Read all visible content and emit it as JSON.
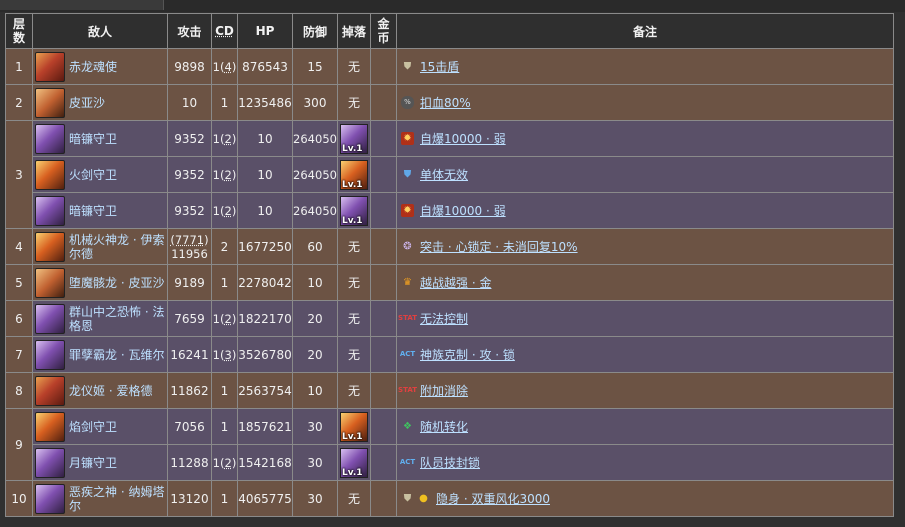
{
  "headers": {
    "floor": [
      "层",
      "数"
    ],
    "enemy": "敌人",
    "attack": "攻击",
    "cd": "CD",
    "hp": "HP",
    "defense": "防御",
    "drop": "掉落",
    "gold": [
      "金",
      "币"
    ],
    "notes": "备注"
  },
  "none_label": "无",
  "drop_level": "Lv.1",
  "rows": [
    {
      "floor": "1",
      "name": "赤龙魂使",
      "attack": "9898",
      "cd": "1(4)",
      "hp": "876543",
      "def": "15",
      "drop": "无",
      "note_icon": "shield-icon",
      "note": "15击盾"
    },
    {
      "floor": "2",
      "name": "皮亚沙",
      "attack": "10",
      "cd": "1",
      "hp": "1235486",
      "def": "300",
      "drop": "无",
      "note_icon": "percent-icon",
      "note": "扣血80%"
    },
    {
      "floor": "3",
      "name": "暗镰守卫",
      "attack": "9352",
      "cd": "1(2)",
      "hp": "10",
      "def": "264050",
      "drop": "Lv.1",
      "note_icon": "bomb-icon",
      "note": "自爆10000 · 弱"
    },
    {
      "floor": "",
      "name": "火剑守卫",
      "attack": "9352",
      "cd": "1(2)",
      "hp": "10",
      "def": "264050",
      "drop": "Lv.1",
      "note_icon": "shield-blue-icon",
      "note": "单体无效"
    },
    {
      "floor": "",
      "name": "暗镰守卫",
      "attack": "9352",
      "cd": "1(2)",
      "hp": "10",
      "def": "264050",
      "drop": "Lv.1",
      "note_icon": "bomb-icon",
      "note": "自爆10000 · 弱"
    },
    {
      "floor": "4",
      "name": "机械火神龙 · 伊索尔德",
      "attack_top": "(7771)",
      "attack": "11956",
      "cd": "2",
      "hp": "1677250",
      "def": "60",
      "drop": "无",
      "note_icon": "swirl-icon",
      "note": "突击 · 心锁定 · 未消回复10%"
    },
    {
      "floor": "5",
      "name": "堕魔骸龙 · 皮亚沙",
      "attack": "9189",
      "cd": "1",
      "hp": "2278042",
      "def": "10",
      "drop": "无",
      "note_icon": "crown-icon",
      "note": "越战越强 · 金"
    },
    {
      "floor": "6",
      "name": "群山中之恐怖 · 法格恩",
      "attack": "7659",
      "cd": "1(2)",
      "hp": "1822170",
      "def": "20",
      "drop": "无",
      "note_icon": "stat-icon",
      "note": "无法控制"
    },
    {
      "floor": "7",
      "name": "罪孽霸龙 · 瓦维尔",
      "attack": "16241",
      "cd": "1(3)",
      "hp": "3526780",
      "def": "20",
      "drop": "无",
      "note_icon": "act-icon",
      "note": "神族克制 · 攻 · 锁"
    },
    {
      "floor": "8",
      "name": "龙仪姬 · 爱格德",
      "attack": "11862",
      "cd": "1",
      "hp": "2563754",
      "def": "10",
      "drop": "无",
      "note_icon": "stat-icon",
      "note": "附加消除"
    },
    {
      "floor": "9",
      "name": "焰剑守卫",
      "attack": "7056",
      "cd": "1",
      "hp": "1857621",
      "def": "30",
      "drop": "Lv.1",
      "note_icon": "random-icon",
      "note": "随机转化"
    },
    {
      "floor": "",
      "name": "月镰守卫",
      "attack": "11288",
      "cd": "1(2)",
      "hp": "1542168",
      "def": "30",
      "drop": "Lv.1",
      "note_icon": "act-icon",
      "note": "队员技封锁"
    },
    {
      "floor": "10",
      "name": "恶疾之神 · 纳姆塔尔",
      "attack": "13120",
      "cd": "1",
      "hp": "4065775",
      "def": "30",
      "drop": "无",
      "note_icon": "shield-gold-icon",
      "note": "隐身 · 双重风化3000"
    }
  ]
}
